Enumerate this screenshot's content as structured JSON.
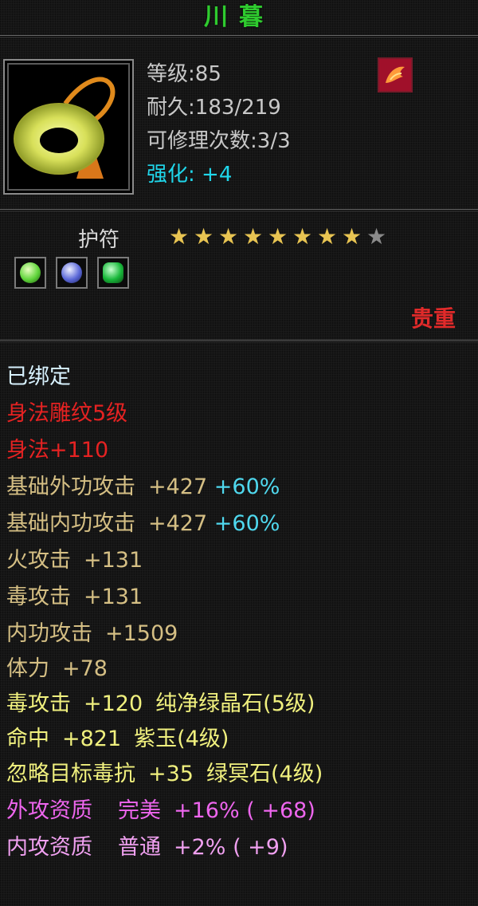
{
  "item": {
    "name": "川暮",
    "level_label": "等级",
    "level": "85",
    "durability_label": "耐久",
    "durability": "183/219",
    "repair_label": "可修理次数",
    "repair": "3/3",
    "enhance_label": "强化",
    "enhance": "+4",
    "type": "护符",
    "stars_total": 9,
    "stars_filled": 8,
    "rarity": "贵重",
    "socket_gems": [
      {
        "icon": "green-gem-icon",
        "color": "#5fd43a"
      },
      {
        "icon": "blue-gem-icon",
        "color": "#5b68d8"
      },
      {
        "icon": "emerald-gem-icon",
        "color": "#18b83a"
      }
    ]
  },
  "attributes": {
    "bound": "已绑定",
    "engraving": "身法雕纹5级",
    "agility": "身法+110",
    "row1": {
      "label": "基础外功攻击",
      "value": "+427",
      "pct": "+60%"
    },
    "row2": {
      "label": "基础内功攻击",
      "value": "+427",
      "pct": "+60%"
    },
    "row3": {
      "label": "火攻击",
      "value": "+131"
    },
    "row4": {
      "label": "毒攻击",
      "value": "+131"
    },
    "row5": {
      "label": "内功攻击",
      "value": "+1509"
    },
    "row6": {
      "label": "体力",
      "value": "+78"
    },
    "row7": {
      "label": "毒攻击",
      "value": "+120",
      "gem": "纯净绿晶石(5级)"
    },
    "row8": {
      "label": "命中",
      "value": "+821",
      "gem": "紫玉(4级)"
    },
    "row9": {
      "label": "忽略目标毒抗",
      "value": "+35",
      "gem": "绿冥石(4级)"
    },
    "row10": {
      "label": "外攻资质",
      "grade": "完美",
      "value": "+16%",
      "extra": "( +68)"
    },
    "row11": {
      "label": "内攻资质",
      "grade": "普通",
      "value": "+2%",
      "extra": "( +9)"
    }
  }
}
